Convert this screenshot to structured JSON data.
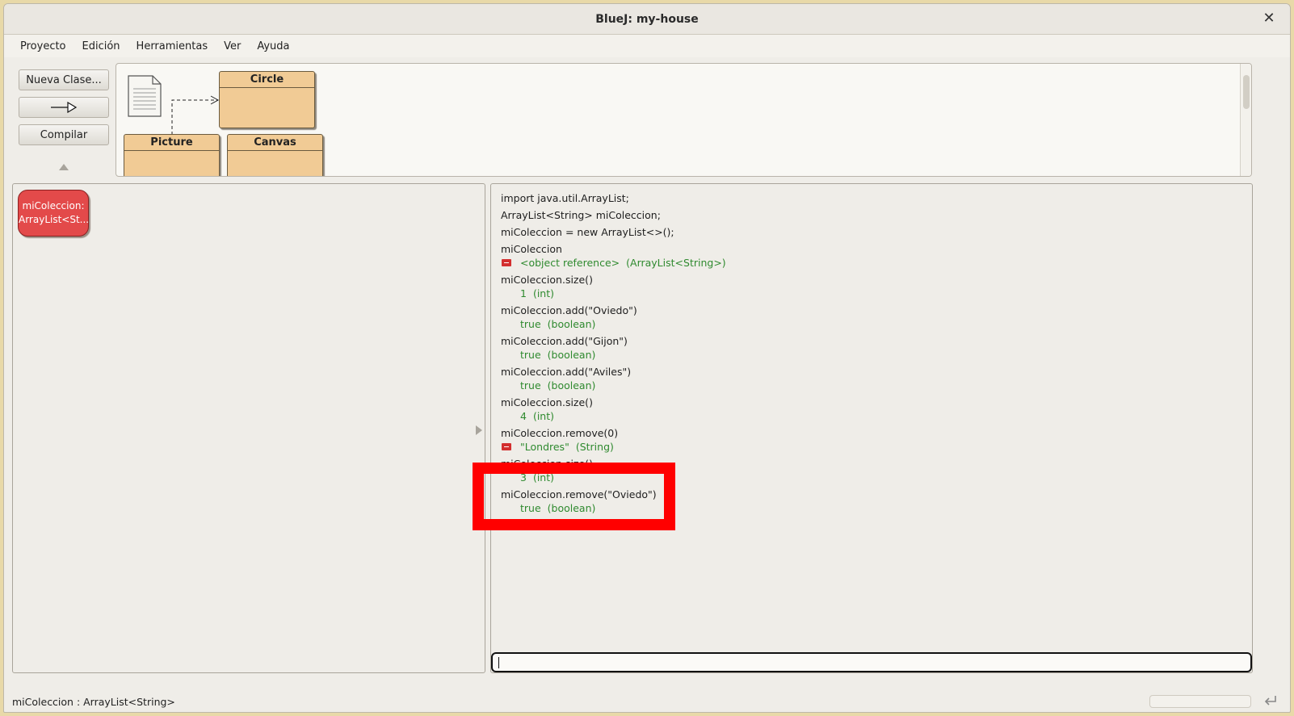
{
  "window": {
    "title": "BlueJ: my-house"
  },
  "menubar": [
    "Proyecto",
    "Edición",
    "Herramientas",
    "Ver",
    "Ayuda"
  ],
  "toolbar": {
    "new_class": "Nueva Clase...",
    "compile": "Compilar"
  },
  "classes": [
    "Circle",
    "Picture",
    "Canvas"
  ],
  "object_bench": {
    "object_line1": "miColeccion:",
    "object_line2": "ArrayList<St..."
  },
  "codepad": {
    "entries": [
      {
        "cmd": "import java.util.ArrayList;"
      },
      {
        "cmd": "ArrayList<String> miColeccion;"
      },
      {
        "cmd": "miColeccion = new ArrayList<>();"
      },
      {
        "cmd": "miColeccion",
        "value": "<object reference>",
        "type": "(ArrayList<String>)",
        "object": true
      },
      {
        "cmd": "miColeccion.size()",
        "value": "1",
        "type": "(int)"
      },
      {
        "cmd": "miColeccion.add(\"Oviedo\")",
        "value": "true",
        "type": "(boolean)"
      },
      {
        "cmd": "miColeccion.add(\"Gijon\")",
        "value": "true",
        "type": "(boolean)"
      },
      {
        "cmd": "miColeccion.add(\"Aviles\")",
        "value": "true",
        "type": "(boolean)"
      },
      {
        "cmd": "miColeccion.size()",
        "value": "4",
        "type": "(int)"
      },
      {
        "cmd": "miColeccion.remove(0)",
        "value": "\"Londres\"",
        "type": "(String)",
        "object": true
      },
      {
        "cmd": "miColeccion.size()",
        "value": "3",
        "type": "(int)"
      },
      {
        "cmd": "miColeccion.remove(\"Oviedo\")",
        "value": "true",
        "type": "(boolean)"
      }
    ]
  },
  "status": {
    "text": "miColeccion : ArrayList<String>"
  },
  "colors": {
    "highlight": "#ff0000",
    "class_fill": "#f1cb95",
    "object_fill": "#e34a4a",
    "result_green": "#2f8a2f"
  }
}
